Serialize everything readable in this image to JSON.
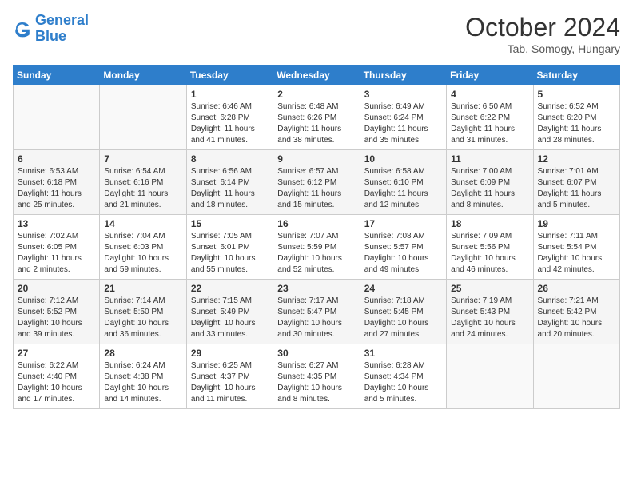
{
  "header": {
    "logo_line1": "General",
    "logo_line2": "Blue",
    "month": "October 2024",
    "location": "Tab, Somogy, Hungary"
  },
  "days_of_week": [
    "Sunday",
    "Monday",
    "Tuesday",
    "Wednesday",
    "Thursday",
    "Friday",
    "Saturday"
  ],
  "weeks": [
    [
      {
        "day": "",
        "sunrise": "",
        "sunset": "",
        "daylight": ""
      },
      {
        "day": "",
        "sunrise": "",
        "sunset": "",
        "daylight": ""
      },
      {
        "day": "1",
        "sunrise": "Sunrise: 6:46 AM",
        "sunset": "Sunset: 6:28 PM",
        "daylight": "Daylight: 11 hours and 41 minutes."
      },
      {
        "day": "2",
        "sunrise": "Sunrise: 6:48 AM",
        "sunset": "Sunset: 6:26 PM",
        "daylight": "Daylight: 11 hours and 38 minutes."
      },
      {
        "day": "3",
        "sunrise": "Sunrise: 6:49 AM",
        "sunset": "Sunset: 6:24 PM",
        "daylight": "Daylight: 11 hours and 35 minutes."
      },
      {
        "day": "4",
        "sunrise": "Sunrise: 6:50 AM",
        "sunset": "Sunset: 6:22 PM",
        "daylight": "Daylight: 11 hours and 31 minutes."
      },
      {
        "day": "5",
        "sunrise": "Sunrise: 6:52 AM",
        "sunset": "Sunset: 6:20 PM",
        "daylight": "Daylight: 11 hours and 28 minutes."
      }
    ],
    [
      {
        "day": "6",
        "sunrise": "Sunrise: 6:53 AM",
        "sunset": "Sunset: 6:18 PM",
        "daylight": "Daylight: 11 hours and 25 minutes."
      },
      {
        "day": "7",
        "sunrise": "Sunrise: 6:54 AM",
        "sunset": "Sunset: 6:16 PM",
        "daylight": "Daylight: 11 hours and 21 minutes."
      },
      {
        "day": "8",
        "sunrise": "Sunrise: 6:56 AM",
        "sunset": "Sunset: 6:14 PM",
        "daylight": "Daylight: 11 hours and 18 minutes."
      },
      {
        "day": "9",
        "sunrise": "Sunrise: 6:57 AM",
        "sunset": "Sunset: 6:12 PM",
        "daylight": "Daylight: 11 hours and 15 minutes."
      },
      {
        "day": "10",
        "sunrise": "Sunrise: 6:58 AM",
        "sunset": "Sunset: 6:10 PM",
        "daylight": "Daylight: 11 hours and 12 minutes."
      },
      {
        "day": "11",
        "sunrise": "Sunrise: 7:00 AM",
        "sunset": "Sunset: 6:09 PM",
        "daylight": "Daylight: 11 hours and 8 minutes."
      },
      {
        "day": "12",
        "sunrise": "Sunrise: 7:01 AM",
        "sunset": "Sunset: 6:07 PM",
        "daylight": "Daylight: 11 hours and 5 minutes."
      }
    ],
    [
      {
        "day": "13",
        "sunrise": "Sunrise: 7:02 AM",
        "sunset": "Sunset: 6:05 PM",
        "daylight": "Daylight: 11 hours and 2 minutes."
      },
      {
        "day": "14",
        "sunrise": "Sunrise: 7:04 AM",
        "sunset": "Sunset: 6:03 PM",
        "daylight": "Daylight: 10 hours and 59 minutes."
      },
      {
        "day": "15",
        "sunrise": "Sunrise: 7:05 AM",
        "sunset": "Sunset: 6:01 PM",
        "daylight": "Daylight: 10 hours and 55 minutes."
      },
      {
        "day": "16",
        "sunrise": "Sunrise: 7:07 AM",
        "sunset": "Sunset: 5:59 PM",
        "daylight": "Daylight: 10 hours and 52 minutes."
      },
      {
        "day": "17",
        "sunrise": "Sunrise: 7:08 AM",
        "sunset": "Sunset: 5:57 PM",
        "daylight": "Daylight: 10 hours and 49 minutes."
      },
      {
        "day": "18",
        "sunrise": "Sunrise: 7:09 AM",
        "sunset": "Sunset: 5:56 PM",
        "daylight": "Daylight: 10 hours and 46 minutes."
      },
      {
        "day": "19",
        "sunrise": "Sunrise: 7:11 AM",
        "sunset": "Sunset: 5:54 PM",
        "daylight": "Daylight: 10 hours and 42 minutes."
      }
    ],
    [
      {
        "day": "20",
        "sunrise": "Sunrise: 7:12 AM",
        "sunset": "Sunset: 5:52 PM",
        "daylight": "Daylight: 10 hours and 39 minutes."
      },
      {
        "day": "21",
        "sunrise": "Sunrise: 7:14 AM",
        "sunset": "Sunset: 5:50 PM",
        "daylight": "Daylight: 10 hours and 36 minutes."
      },
      {
        "day": "22",
        "sunrise": "Sunrise: 7:15 AM",
        "sunset": "Sunset: 5:49 PM",
        "daylight": "Daylight: 10 hours and 33 minutes."
      },
      {
        "day": "23",
        "sunrise": "Sunrise: 7:17 AM",
        "sunset": "Sunset: 5:47 PM",
        "daylight": "Daylight: 10 hours and 30 minutes."
      },
      {
        "day": "24",
        "sunrise": "Sunrise: 7:18 AM",
        "sunset": "Sunset: 5:45 PM",
        "daylight": "Daylight: 10 hours and 27 minutes."
      },
      {
        "day": "25",
        "sunrise": "Sunrise: 7:19 AM",
        "sunset": "Sunset: 5:43 PM",
        "daylight": "Daylight: 10 hours and 24 minutes."
      },
      {
        "day": "26",
        "sunrise": "Sunrise: 7:21 AM",
        "sunset": "Sunset: 5:42 PM",
        "daylight": "Daylight: 10 hours and 20 minutes."
      }
    ],
    [
      {
        "day": "27",
        "sunrise": "Sunrise: 6:22 AM",
        "sunset": "Sunset: 4:40 PM",
        "daylight": "Daylight: 10 hours and 17 minutes."
      },
      {
        "day": "28",
        "sunrise": "Sunrise: 6:24 AM",
        "sunset": "Sunset: 4:38 PM",
        "daylight": "Daylight: 10 hours and 14 minutes."
      },
      {
        "day": "29",
        "sunrise": "Sunrise: 6:25 AM",
        "sunset": "Sunset: 4:37 PM",
        "daylight": "Daylight: 10 hours and 11 minutes."
      },
      {
        "day": "30",
        "sunrise": "Sunrise: 6:27 AM",
        "sunset": "Sunset: 4:35 PM",
        "daylight": "Daylight: 10 hours and 8 minutes."
      },
      {
        "day": "31",
        "sunrise": "Sunrise: 6:28 AM",
        "sunset": "Sunset: 4:34 PM",
        "daylight": "Daylight: 10 hours and 5 minutes."
      },
      {
        "day": "",
        "sunrise": "",
        "sunset": "",
        "daylight": ""
      },
      {
        "day": "",
        "sunrise": "",
        "sunset": "",
        "daylight": ""
      }
    ]
  ]
}
